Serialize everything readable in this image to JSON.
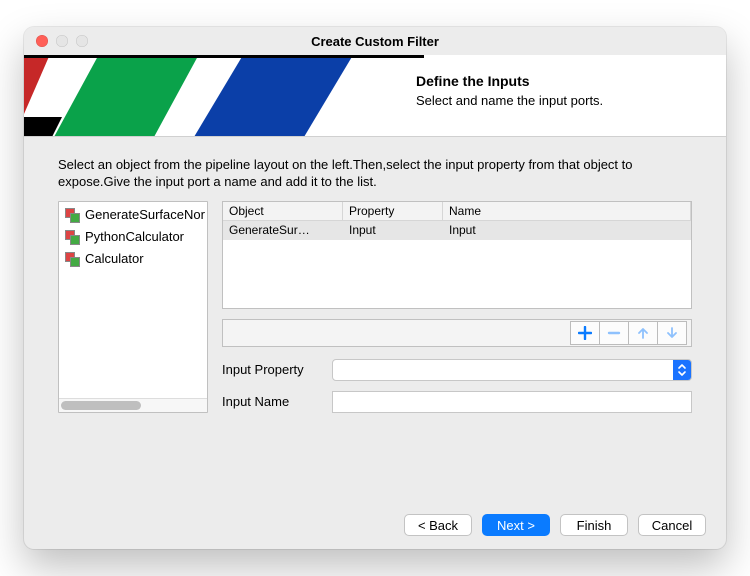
{
  "window": {
    "title": "Create Custom Filter"
  },
  "banner": {
    "heading": "Define the Inputs",
    "subheading": "Select and name the input ports."
  },
  "instructions": "Select an object from the pipeline layout on the left.Then,select the input property from that object to expose.Give the input port a name and add it to the list.",
  "pipeline": {
    "items": [
      {
        "label": "GenerateSurfaceNormals"
      },
      {
        "label": "PythonCalculator"
      },
      {
        "label": "Calculator"
      }
    ]
  },
  "table": {
    "columns": [
      "Object",
      "Property",
      "Name"
    ],
    "rows": [
      {
        "object": "GenerateSur…",
        "property": "Input",
        "name": "Input"
      }
    ]
  },
  "toolbar": {
    "add": "+",
    "remove": "−",
    "up": "↑",
    "down": "↓"
  },
  "form": {
    "property_label": "Input Property",
    "property_value": "",
    "name_label": "Input Name",
    "name_value": ""
  },
  "footer": {
    "back": "< Back",
    "next": "Next >",
    "finish": "Finish",
    "cancel": "Cancel"
  }
}
